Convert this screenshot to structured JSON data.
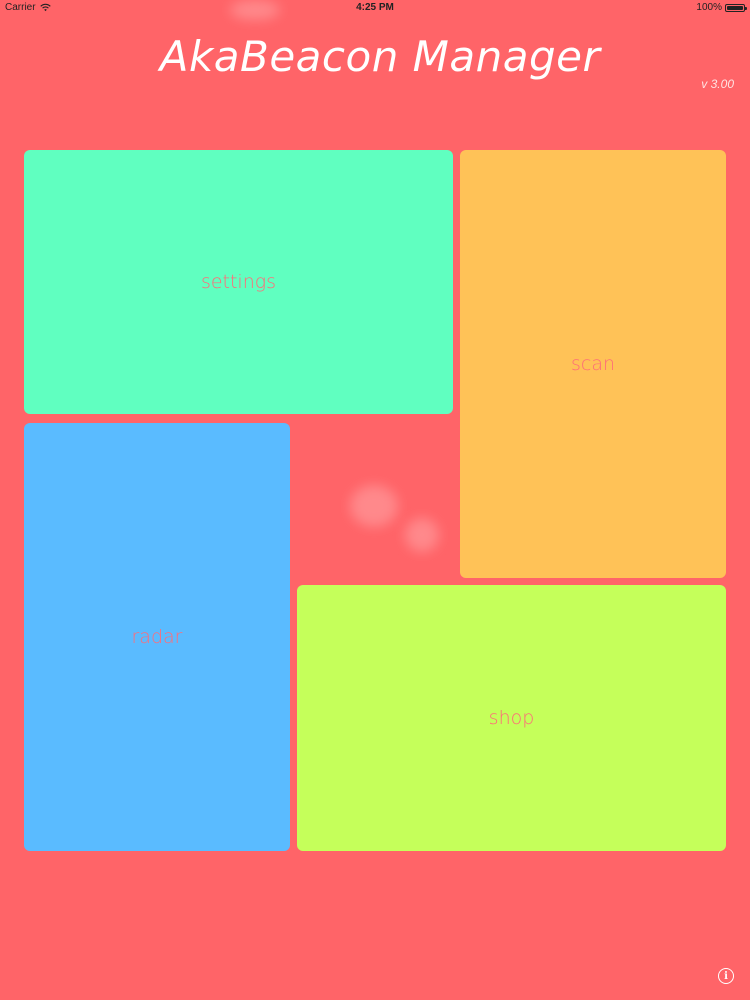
{
  "status_bar": {
    "carrier": "Carrier",
    "time": "4:25 PM",
    "battery": "100%",
    "battery_level": 1.0,
    "icons": [
      "wifi-icon",
      "battery-icon"
    ]
  },
  "header": {
    "title": "AkaBeacon Manager",
    "version": "v 3.00"
  },
  "tiles": {
    "settings": {
      "label": "settings",
      "color": "#60ffc0"
    },
    "scan": {
      "label": "scan",
      "color": "#ffc257"
    },
    "radar": {
      "label": "radar",
      "color": "#5abbff"
    },
    "shop": {
      "label": "shop",
      "color": "#c5ff5a"
    }
  },
  "footer": {
    "info_icon": "info-icon"
  },
  "colors": {
    "background": "#ff6468",
    "label_text": "#ff6c78"
  }
}
